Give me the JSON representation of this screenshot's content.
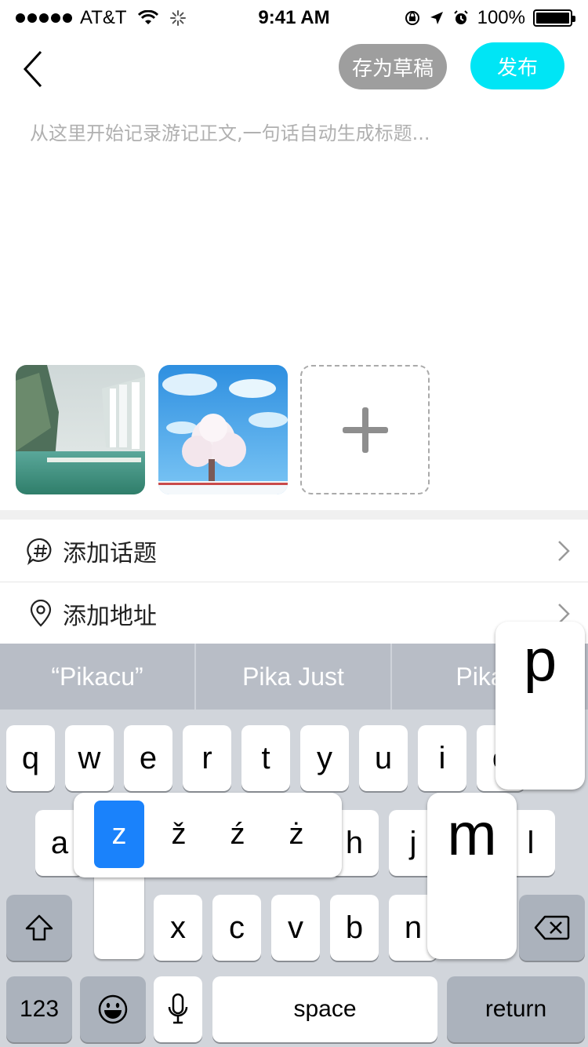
{
  "status_bar": {
    "carrier": "AT&T",
    "time": "9:41 AM",
    "battery": "100%"
  },
  "toolbar": {
    "draft_label": "存为草稿",
    "publish_label": "发布",
    "draft_color": "#9e9e9e",
    "publish_color": "#00e5f5"
  },
  "editor": {
    "placeholder": "从这里开始记录游记正文,一句话自动生成标题..."
  },
  "options": {
    "topic_label": "添加话题",
    "address_label": "添加地址"
  },
  "keyboard": {
    "predictions": [
      "“Pikacu”",
      "Pika Just",
      "Pika J"
    ],
    "row1": [
      "q",
      "w",
      "e",
      "r",
      "t",
      "y",
      "u",
      "i",
      "o"
    ],
    "row2": [
      "a",
      "h",
      "j",
      "l"
    ],
    "row3": [
      "x",
      "c",
      "v",
      "b",
      "n"
    ],
    "accent_options": [
      "z",
      "ž",
      "ź",
      "ż"
    ],
    "magnified_p": "p",
    "magnified_m": "m",
    "numbers_label": "123",
    "space_label": "space",
    "return_label": "return",
    "accent_selected_color": "#1a82fb"
  }
}
